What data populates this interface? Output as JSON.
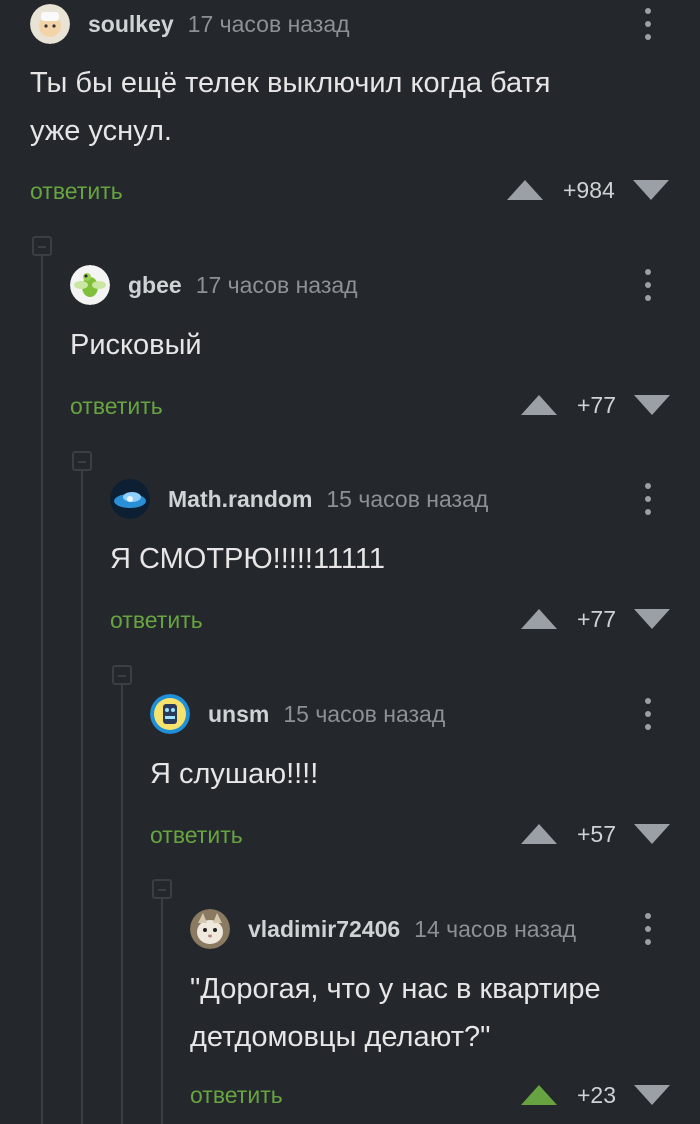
{
  "comments": [
    {
      "username": "soulkey",
      "time": "17 часов назад",
      "text": "Ты бы ещё телек выключил когда батя\nуже уснул.",
      "reply": "ответить",
      "score": "+984",
      "upvoted": false
    },
    {
      "username": "gbee",
      "time": "17 часов назад",
      "text": "Рисковый",
      "reply": "ответить",
      "score": "+77",
      "upvoted": false
    },
    {
      "username": "Math.random",
      "time": "15 часов назад",
      "text": "Я СМОТРЮ!!!!!11111",
      "reply": "ответить",
      "score": "+77",
      "upvoted": false
    },
    {
      "username": "unsm",
      "time": "15 часов назад",
      "text": "Я слушаю!!!!",
      "reply": "ответить",
      "score": "+57",
      "upvoted": false
    },
    {
      "username": "vladimir72406",
      "time": "14 часов назад",
      "text": "\"Дорогая, что у нас в квартире\nдетдомовцы делают?\"",
      "reply": "ответить",
      "score": "+23",
      "upvoted": true
    }
  ],
  "colors": {
    "background": "#24272b",
    "accent": "#67a441",
    "muted": "#8c9196",
    "thread": "#3b3f44"
  },
  "icons": {
    "menu": "kebab-menu-icon",
    "up": "upvote-arrow-icon",
    "down": "downvote-arrow-icon",
    "collapse": "collapse-thread-icon"
  }
}
